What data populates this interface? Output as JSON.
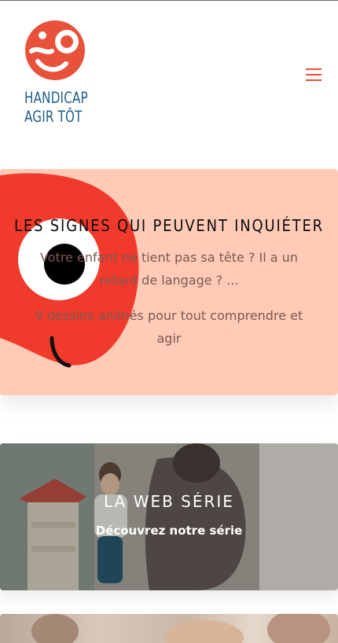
{
  "brand": {
    "logo_line1": "HANDICAP",
    "logo_line2": "AGIR TÔT",
    "colors": {
      "accent": "#e8513a",
      "logo_text": "#1f5f86",
      "card_peach": "#ffcbb7"
    }
  },
  "header": {
    "menu_icon": "hamburger-icon"
  },
  "cards": [
    {
      "title": "LES SIGNES QUI PEUVENT INQUIÉTER",
      "paragraph1": "Votre enfant ne tient pas sa tête ? Il a un retard de langage ? ...",
      "paragraph2": "9 dessins animés pour tout comprendre et agir"
    },
    {
      "title": "LA WEB SÉRIE",
      "subtitle": "Découvrez notre série"
    }
  ]
}
